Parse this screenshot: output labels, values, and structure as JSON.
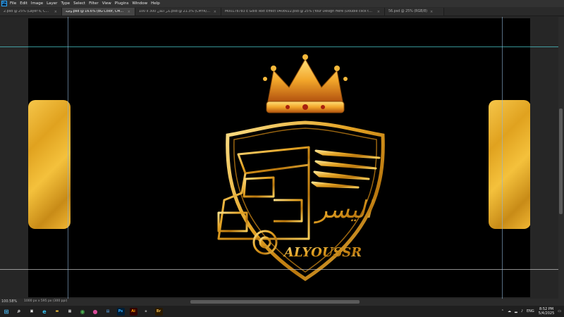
{
  "menubar": {
    "logo": "Ps",
    "items": [
      "File",
      "Edit",
      "Image",
      "Layer",
      "Type",
      "Select",
      "Filter",
      "View",
      "Plugins",
      "Window",
      "Help"
    ]
  },
  "tabs": [
    {
      "label": "2.psd @ 25% (Layer 6, CMYK/8#)",
      "active": false
    },
    {
      "label": "وجيه.psd @ 16.6% (BG Color, CMYK/8#) *",
      "active": true
    },
    {
      "label": "100 x 300 بانر اعلان.psd @ 21.3% (CMYK/8#)",
      "active": false
    },
    {
      "label": "M00178783 E Gold Text Effect 040ov22.psd @ 25% (Your Design Here (Double click to edit), RGB/8#) *",
      "active": false
    },
    {
      "label": "56.psd @ 25% (RGB/8)",
      "active": false
    }
  ],
  "tab_close": "×",
  "canvas": {
    "brand_arabic": "اليسر",
    "brand_latin": "ALYOUSSR"
  },
  "statusbar": {
    "zoom": "100.58%",
    "doc_info": "1000 px x 595 px (300 ppi)"
  },
  "taskbar": {
    "apps": [
      {
        "name": "windows-start",
        "glyph": "⊞",
        "color": "#4cc2ff"
      },
      {
        "name": "search",
        "glyph": "⌕",
        "color": "#ffffff"
      },
      {
        "name": "task-view",
        "glyph": "▣",
        "color": "#ffffff"
      },
      {
        "name": "edge",
        "glyph": "e",
        "color": "#35c1f1"
      },
      {
        "name": "file-explorer",
        "glyph": "▬",
        "color": "#f3c13a"
      },
      {
        "name": "store",
        "glyph": "▦",
        "color": "#ffffff"
      },
      {
        "name": "chrome",
        "glyph": "◉",
        "color": "#4caf50"
      },
      {
        "name": "app-pink",
        "glyph": "●",
        "color": "#d94c9a"
      },
      {
        "name": "image-viewer",
        "glyph": "▤",
        "color": "#5fb2ff"
      },
      {
        "name": "photoshop",
        "glyph": "Ps",
        "color": "#31a8ff"
      },
      {
        "name": "illustrator",
        "glyph": "Ai",
        "color": "#ff9a00"
      },
      {
        "name": "app-dark",
        "glyph": "▪",
        "color": "#888888"
      },
      {
        "name": "bridge",
        "glyph": "Br",
        "color": "#e8b34a"
      }
    ],
    "tray": {
      "language": "ENG",
      "time": "8:52 PM",
      "date": "5/4/2025"
    }
  },
  "colors": {
    "gold": "#e4a826",
    "guide_cyan": "#4fd2d6",
    "ps_blue": "#31a8ff"
  }
}
